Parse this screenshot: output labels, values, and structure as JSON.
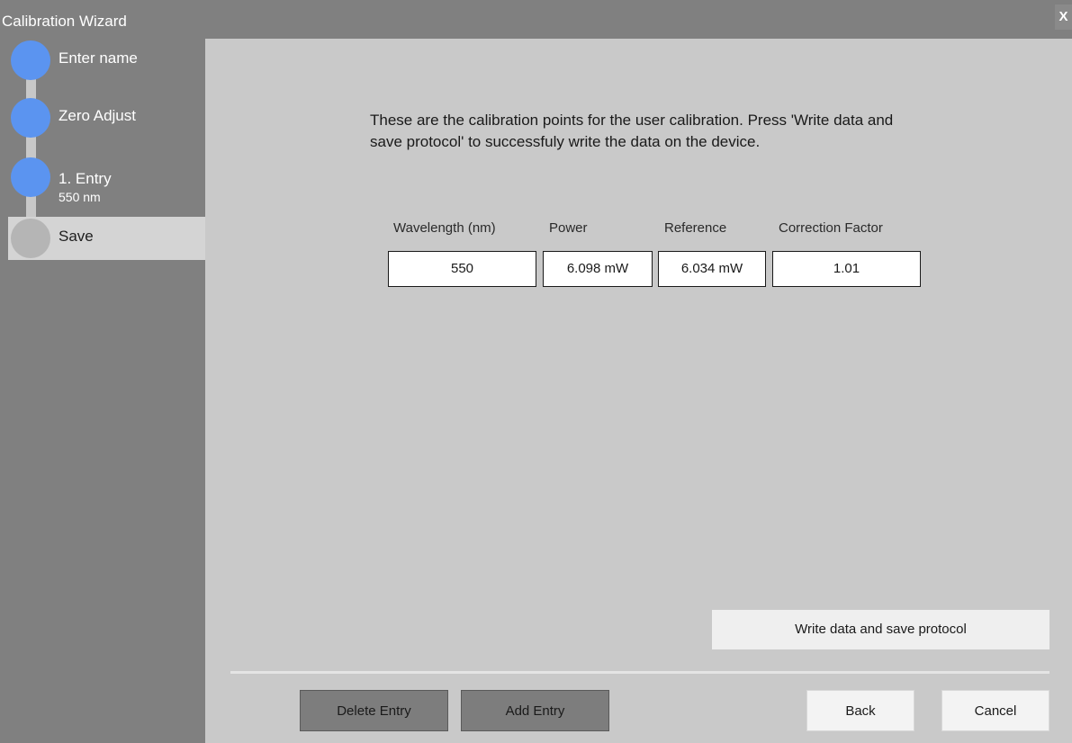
{
  "window": {
    "title": "Calibration Wizard",
    "close_label": "X"
  },
  "steps": [
    {
      "label": "Enter name",
      "sub": "",
      "state": "done"
    },
    {
      "label": "Zero Adjust",
      "sub": "",
      "state": "done"
    },
    {
      "label": "1. Entry",
      "sub": "550 nm",
      "state": "done"
    },
    {
      "label": "Save",
      "sub": "",
      "state": "current"
    }
  ],
  "description": "These are the calibration points for the user calibration. Press 'Write data and save protocol' to successfuly write the data on the device.",
  "table": {
    "headers": [
      "Wavelength (nm)",
      "Power",
      "Reference",
      "Correction Factor"
    ],
    "rows": [
      [
        "550",
        "6.098 mW",
        "6.034 mW",
        "1.01"
      ]
    ]
  },
  "buttons": {
    "write_save": "Write data and save protocol",
    "delete_entry": "Delete Entry",
    "add_entry": "Add Entry",
    "back": "Back",
    "cancel": "Cancel"
  },
  "colors": {
    "step_done": "#5b94f0",
    "step_pending": "#b5b5b5",
    "sidebar": "#808080",
    "content": "#c9c9c9"
  }
}
